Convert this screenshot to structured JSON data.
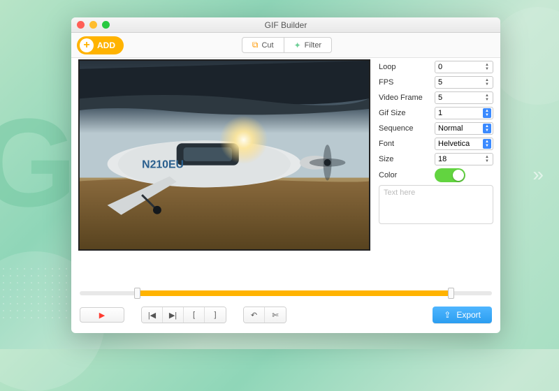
{
  "window": {
    "title": "GIF Builder"
  },
  "toolbar": {
    "add_label": "ADD",
    "cut_label": "Cut",
    "filter_label": "Filter"
  },
  "preview": {
    "aircraft_reg": "N210EU"
  },
  "settings": {
    "loop": {
      "label": "Loop",
      "value": "0"
    },
    "fps": {
      "label": "FPS",
      "value": "5"
    },
    "vframe": {
      "label": "Video Frame",
      "value": "5"
    },
    "gifsize": {
      "label": "Gif Size",
      "value": "1"
    },
    "sequence": {
      "label": "Sequence",
      "value": "Normal"
    },
    "font": {
      "label": "Font",
      "value": "Helvetica"
    },
    "size": {
      "label": "Size",
      "value": "18"
    },
    "color": {
      "label": "Color"
    },
    "text_placeholder": "Text here"
  },
  "transport": {
    "play": "▶",
    "prev": "|◀",
    "next": "▶|",
    "mark_in": "[",
    "mark_out": "]",
    "undo": "↶",
    "cut": "✄"
  },
  "export": {
    "label": "Export"
  }
}
